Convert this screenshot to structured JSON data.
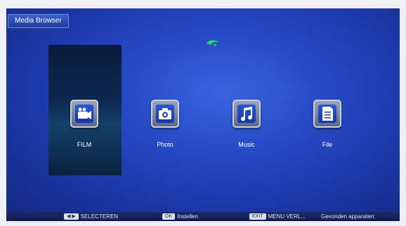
{
  "window": {
    "title": "Media Browser"
  },
  "media_items": [
    {
      "label": "FILM",
      "icon": "film-camera-icon",
      "selected": true
    },
    {
      "label": "Photo",
      "icon": "photo-camera-icon",
      "selected": false
    },
    {
      "label": "Music",
      "icon": "music-note-icon",
      "selected": false
    },
    {
      "label": "File",
      "icon": "document-icon",
      "selected": false
    }
  ],
  "footer": {
    "select_key": "◀ ▶",
    "select_label": "SELECTEREN",
    "ok_key": "OK",
    "ok_label": "Instellen",
    "exit_key": "EXIT",
    "exit_label": "MENU VERL...",
    "found_devices_label": "Gevonden apparaten:"
  },
  "colors": {
    "background": "#2548c4",
    "selection": "#0d2a52",
    "tile_border": "#c8d0de"
  }
}
